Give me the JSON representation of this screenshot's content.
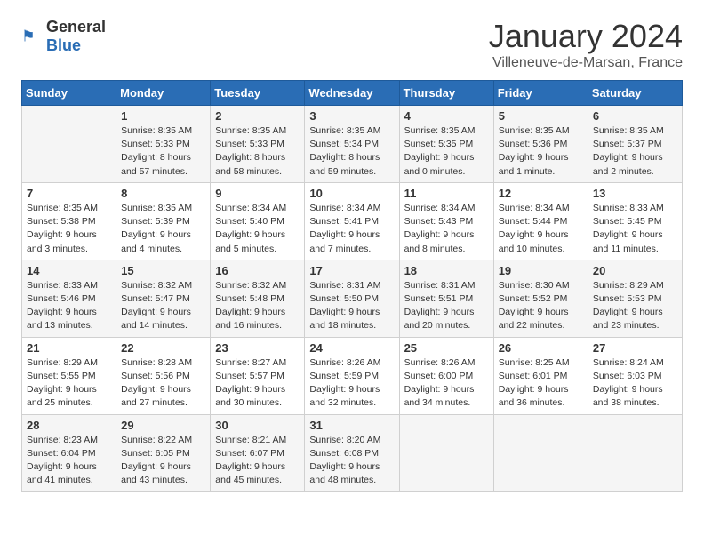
{
  "logo": {
    "text_general": "General",
    "text_blue": "Blue"
  },
  "header": {
    "title": "January 2024",
    "subtitle": "Villeneuve-de-Marsan, France"
  },
  "columns": [
    "Sunday",
    "Monday",
    "Tuesday",
    "Wednesday",
    "Thursday",
    "Friday",
    "Saturday"
  ],
  "weeks": [
    [
      {
        "day": "",
        "info": ""
      },
      {
        "day": "1",
        "info": "Sunrise: 8:35 AM\nSunset: 5:33 PM\nDaylight: 8 hours\nand 57 minutes."
      },
      {
        "day": "2",
        "info": "Sunrise: 8:35 AM\nSunset: 5:33 PM\nDaylight: 8 hours\nand 58 minutes."
      },
      {
        "day": "3",
        "info": "Sunrise: 8:35 AM\nSunset: 5:34 PM\nDaylight: 8 hours\nand 59 minutes."
      },
      {
        "day": "4",
        "info": "Sunrise: 8:35 AM\nSunset: 5:35 PM\nDaylight: 9 hours\nand 0 minutes."
      },
      {
        "day": "5",
        "info": "Sunrise: 8:35 AM\nSunset: 5:36 PM\nDaylight: 9 hours\nand 1 minute."
      },
      {
        "day": "6",
        "info": "Sunrise: 8:35 AM\nSunset: 5:37 PM\nDaylight: 9 hours\nand 2 minutes."
      }
    ],
    [
      {
        "day": "7",
        "info": "Sunrise: 8:35 AM\nSunset: 5:38 PM\nDaylight: 9 hours\nand 3 minutes."
      },
      {
        "day": "8",
        "info": "Sunrise: 8:35 AM\nSunset: 5:39 PM\nDaylight: 9 hours\nand 4 minutes."
      },
      {
        "day": "9",
        "info": "Sunrise: 8:34 AM\nSunset: 5:40 PM\nDaylight: 9 hours\nand 5 minutes."
      },
      {
        "day": "10",
        "info": "Sunrise: 8:34 AM\nSunset: 5:41 PM\nDaylight: 9 hours\nand 7 minutes."
      },
      {
        "day": "11",
        "info": "Sunrise: 8:34 AM\nSunset: 5:43 PM\nDaylight: 9 hours\nand 8 minutes."
      },
      {
        "day": "12",
        "info": "Sunrise: 8:34 AM\nSunset: 5:44 PM\nDaylight: 9 hours\nand 10 minutes."
      },
      {
        "day": "13",
        "info": "Sunrise: 8:33 AM\nSunset: 5:45 PM\nDaylight: 9 hours\nand 11 minutes."
      }
    ],
    [
      {
        "day": "14",
        "info": "Sunrise: 8:33 AM\nSunset: 5:46 PM\nDaylight: 9 hours\nand 13 minutes."
      },
      {
        "day": "15",
        "info": "Sunrise: 8:32 AM\nSunset: 5:47 PM\nDaylight: 9 hours\nand 14 minutes."
      },
      {
        "day": "16",
        "info": "Sunrise: 8:32 AM\nSunset: 5:48 PM\nDaylight: 9 hours\nand 16 minutes."
      },
      {
        "day": "17",
        "info": "Sunrise: 8:31 AM\nSunset: 5:50 PM\nDaylight: 9 hours\nand 18 minutes."
      },
      {
        "day": "18",
        "info": "Sunrise: 8:31 AM\nSunset: 5:51 PM\nDaylight: 9 hours\nand 20 minutes."
      },
      {
        "day": "19",
        "info": "Sunrise: 8:30 AM\nSunset: 5:52 PM\nDaylight: 9 hours\nand 22 minutes."
      },
      {
        "day": "20",
        "info": "Sunrise: 8:29 AM\nSunset: 5:53 PM\nDaylight: 9 hours\nand 23 minutes."
      }
    ],
    [
      {
        "day": "21",
        "info": "Sunrise: 8:29 AM\nSunset: 5:55 PM\nDaylight: 9 hours\nand 25 minutes."
      },
      {
        "day": "22",
        "info": "Sunrise: 8:28 AM\nSunset: 5:56 PM\nDaylight: 9 hours\nand 27 minutes."
      },
      {
        "day": "23",
        "info": "Sunrise: 8:27 AM\nSunset: 5:57 PM\nDaylight: 9 hours\nand 30 minutes."
      },
      {
        "day": "24",
        "info": "Sunrise: 8:26 AM\nSunset: 5:59 PM\nDaylight: 9 hours\nand 32 minutes."
      },
      {
        "day": "25",
        "info": "Sunrise: 8:26 AM\nSunset: 6:00 PM\nDaylight: 9 hours\nand 34 minutes."
      },
      {
        "day": "26",
        "info": "Sunrise: 8:25 AM\nSunset: 6:01 PM\nDaylight: 9 hours\nand 36 minutes."
      },
      {
        "day": "27",
        "info": "Sunrise: 8:24 AM\nSunset: 6:03 PM\nDaylight: 9 hours\nand 38 minutes."
      }
    ],
    [
      {
        "day": "28",
        "info": "Sunrise: 8:23 AM\nSunset: 6:04 PM\nDaylight: 9 hours\nand 41 minutes."
      },
      {
        "day": "29",
        "info": "Sunrise: 8:22 AM\nSunset: 6:05 PM\nDaylight: 9 hours\nand 43 minutes."
      },
      {
        "day": "30",
        "info": "Sunrise: 8:21 AM\nSunset: 6:07 PM\nDaylight: 9 hours\nand 45 minutes."
      },
      {
        "day": "31",
        "info": "Sunrise: 8:20 AM\nSunset: 6:08 PM\nDaylight: 9 hours\nand 48 minutes."
      },
      {
        "day": "",
        "info": ""
      },
      {
        "day": "",
        "info": ""
      },
      {
        "day": "",
        "info": ""
      }
    ]
  ]
}
